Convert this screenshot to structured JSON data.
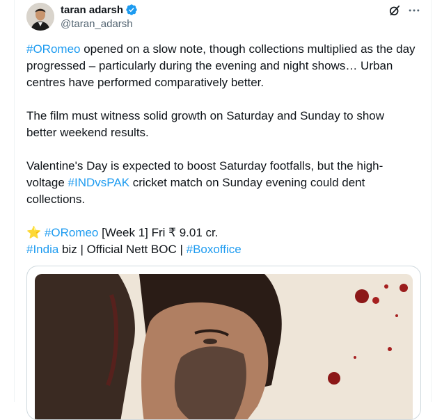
{
  "author": {
    "display_name": "taran adarsh",
    "handle": "@taran_adarsh"
  },
  "tweet": {
    "para1": {
      "hashtag": "#ORomeo",
      "text": " opened on a slow note, though collections multiplied as the day progressed – particularly during the evening and night shows… Urban centres have performed comparatively better."
    },
    "para2": "The film must witness solid growth on Saturday and Sunday to show better weekend results.",
    "para3": {
      "before": "Valentine's Day is expected to boost Saturday footfalls, but the high-voltage ",
      "hashtag": "#INDvsPAK",
      "after": " cricket match on Sunday evening could dent collections."
    },
    "line4": {
      "star": "⭐",
      "hashtag": "#ORomeo",
      "text": " [Week 1] Fri ₹ 9.01 cr."
    },
    "line5": {
      "hashtag1": "#India",
      "middle": " biz | Official Nett BOC | ",
      "hashtag2": "#Boxoffice"
    }
  },
  "icons": {
    "verified": "verified-badge-icon",
    "grok": "grok-icon",
    "more": "more-options-icon"
  },
  "colors": {
    "link": "#1d9bf0",
    "text": "#0f1419",
    "muted": "#536471",
    "verified": "#1d9bf0"
  }
}
